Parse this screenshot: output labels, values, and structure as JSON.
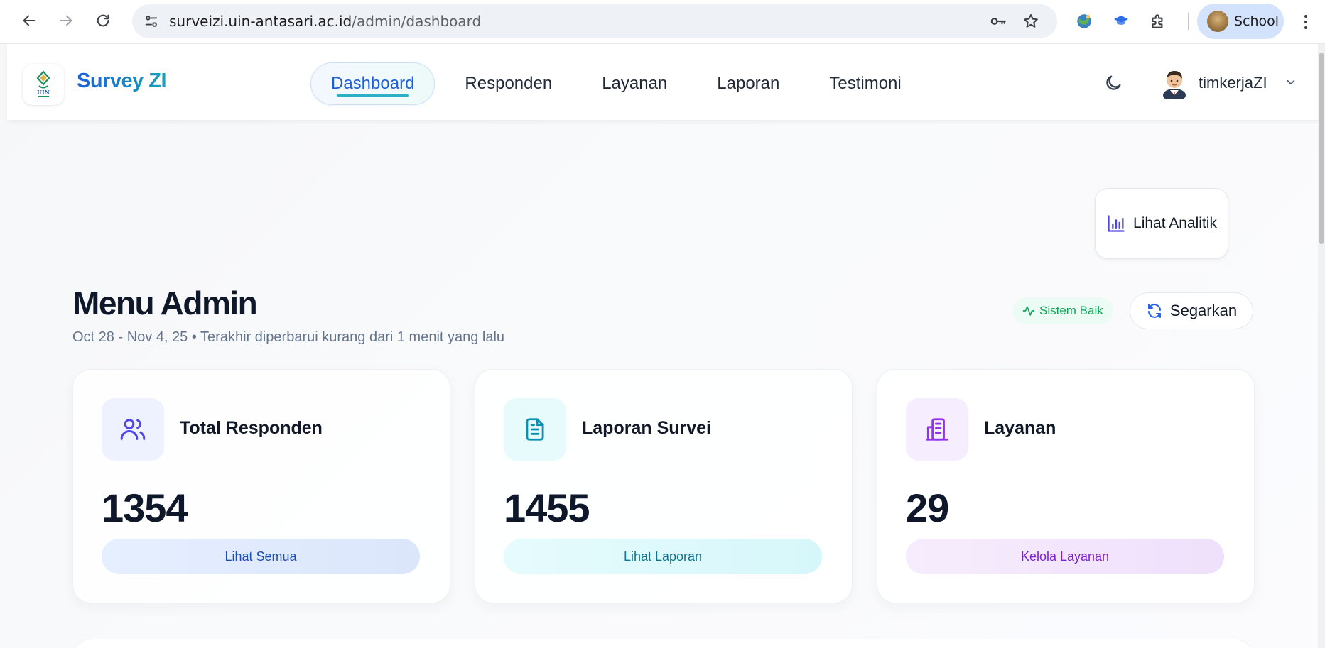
{
  "browser": {
    "url_host": "surveizi.uin-antasari.ac.id",
    "url_path": "/admin/dashboard",
    "profile_label": "School"
  },
  "app": {
    "brand": "Survey ZI",
    "nav": {
      "tabs": [
        "Dashboard",
        "Responden",
        "Layanan",
        "Laporan",
        "Testimoni"
      ],
      "active_tab": "Dashboard"
    },
    "user": {
      "name": "timkerjaZI"
    }
  },
  "analytics_button": {
    "label": "Lihat Analitik"
  },
  "page": {
    "title": "Menu Admin",
    "subtitle": "Oct 28 - Nov 4, 25 • Terakhir diperbarui kurang dari 1 menit yang lalu",
    "status": "Sistem Baik",
    "refresh": "Segarkan"
  },
  "cards": [
    {
      "title": "Total Responden",
      "value": "1354",
      "button": "Lihat Semua",
      "icon": "users-icon",
      "accent": "#4f46e5"
    },
    {
      "title": "Laporan Survei",
      "value": "1455",
      "button": "Lihat Laporan",
      "icon": "file-text-icon",
      "accent": "#0891b2"
    },
    {
      "title": "Layanan",
      "value": "29",
      "button": "Kelola Layanan",
      "icon": "building-icon",
      "accent": "#9333ea"
    }
  ],
  "colors": {
    "brand_blue": "#1e5fd6",
    "brand_teal": "#16a3b8",
    "status_green": "#15a05a"
  }
}
